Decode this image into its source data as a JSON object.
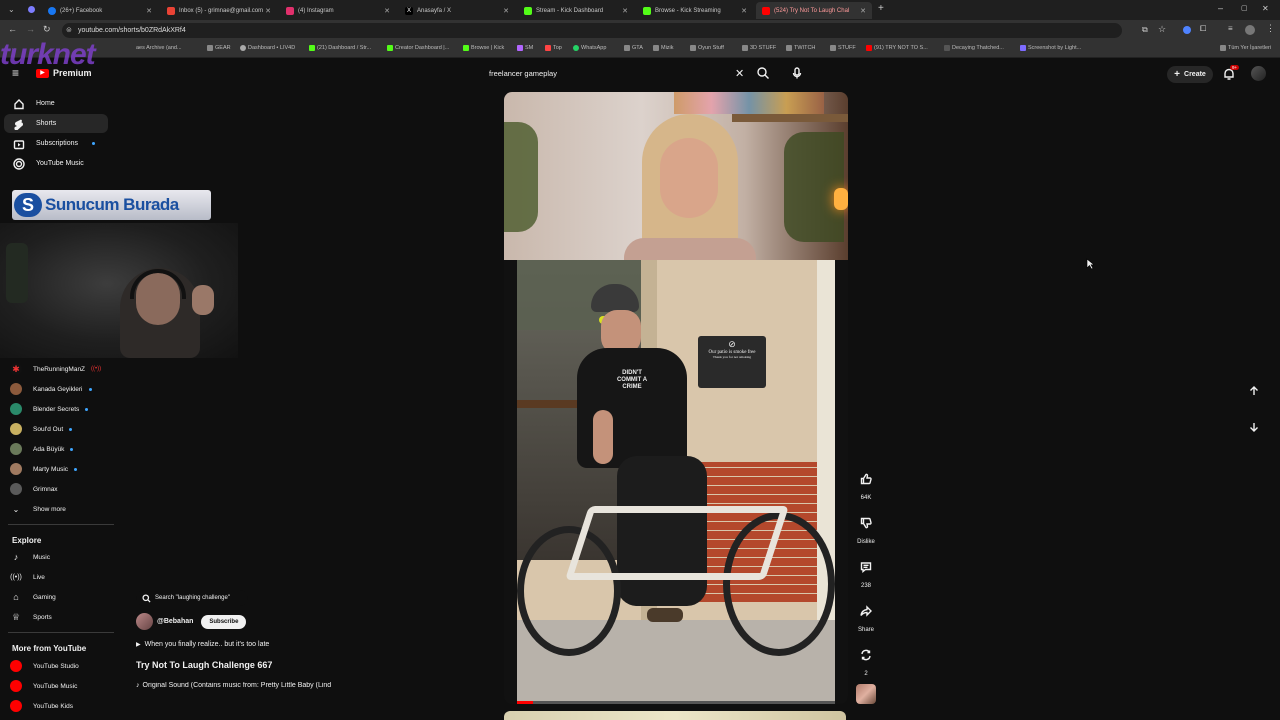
{
  "browser": {
    "tabs": [
      {
        "label": "(26+) Facebook",
        "color": "#1877f2"
      },
      {
        "label": "Inbox (5) - grimnae@gmail.com",
        "color": "#ea4335"
      },
      {
        "label": "(4) Instagram",
        "color": "#e1306c"
      },
      {
        "label": "Anasayfa / X",
        "color": "#000000"
      },
      {
        "label": "Stream - Kick Dashboard",
        "color": "#53fc18"
      },
      {
        "label": "Browse - Kick Streaming",
        "color": "#53fc18"
      },
      {
        "label": "(524) Try Not To Laugh Chal",
        "color": "#ff0000"
      }
    ],
    "url": "youtube.com/shorts/b0ZRdAkXRf4",
    "bookmarks": [
      "...",
      "aes Archive (and...",
      "GEAR",
      "Dashboard • LIV4D",
      "(21) Dashboard / Str...",
      "Creator Dashboard |...",
      "Browse | Kick",
      "SM",
      "Top",
      "WhatsApp",
      "GTA",
      "Mizik",
      "Oyun Stuff",
      "3D STUFF",
      "TWITCH",
      "STUFF",
      "(91) TRY NOT TO S...",
      "Decaying Thatched...",
      "Screenshot by Light...",
      "Tüm Yer İşaretleri"
    ]
  },
  "overlay": {
    "logo_text": "turknet",
    "banner_text": "Sunucum Burada"
  },
  "header": {
    "brand": "Premium",
    "search_value": "freelancer gameplay",
    "create_label": "Create",
    "notif_badge": "9+"
  },
  "sidebar": {
    "primary": [
      "Home",
      "Shorts",
      "Subscriptions",
      "YouTube Music"
    ],
    "subscriptions": [
      {
        "name": "TheRunningManZ",
        "live": true
      },
      {
        "name": "Kanada Geyikleri",
        "live": false
      },
      {
        "name": "Blender Secrets",
        "live": false
      },
      {
        "name": "Soul'd Out",
        "live": false
      },
      {
        "name": "Ada Büyük",
        "live": false
      },
      {
        "name": "Marty Music",
        "live": false
      },
      {
        "name": "Grimnax",
        "live": false
      }
    ],
    "show_more": "Show more",
    "explore_title": "Explore",
    "explore": [
      "Music",
      "Live",
      "Gaming",
      "Sports"
    ],
    "more_title": "More from YouTube",
    "more": [
      "YouTube Studio",
      "YouTube Music",
      "YouTube Kids"
    ]
  },
  "short": {
    "search_chip": "Search \"laughing challenge\"",
    "channel": "@Bebahan",
    "subscribe": "Subscribe",
    "caption": "When you finally realize.. but it's too late",
    "title": "Try Not To Laugh Challenge 667",
    "sound": "Original Sound (Contains music from: Pretty Little Baby (Lind",
    "sign_line1": "Our patio is smoke free",
    "sign_line2": "Thank you for not smoking",
    "shirt_text": "DIDN'T COMMIT A CRIME"
  },
  "actions": {
    "likes": "64K",
    "dislike": "Dislike",
    "comments": "238",
    "share": "Share",
    "remix": "2"
  }
}
